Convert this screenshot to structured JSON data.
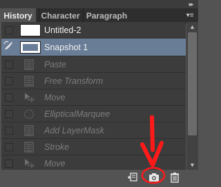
{
  "tabs": [
    {
      "label": "History",
      "active": true
    },
    {
      "label": "Character",
      "active": false
    },
    {
      "label": "Paragraph",
      "active": false
    }
  ],
  "icons": {
    "collapse": "double-chevron-right",
    "panel_menu": "panel-menu",
    "history_brush": "history-brush",
    "step_document": "document",
    "step_move": "move-tool",
    "step_marquee": "elliptical-marquee",
    "new_document": "new-document-from-state",
    "new_snapshot": "camera",
    "delete": "trash"
  },
  "snapshots": [
    {
      "label": "Untitled-2",
      "selected": false
    },
    {
      "label": "Snapshot 1",
      "selected": true,
      "history_source": true
    }
  ],
  "history_steps": [
    {
      "label": "Paste",
      "icon": "document"
    },
    {
      "label": "Free Transform",
      "icon": "document"
    },
    {
      "label": "Move",
      "icon": "move-tool"
    },
    {
      "label": "EllipticalMarquee",
      "icon": "elliptical-marquee"
    },
    {
      "label": "Add LayerMask",
      "icon": "document"
    },
    {
      "label": "Stroke",
      "icon": "document"
    },
    {
      "label": "Move",
      "icon": "move-tool"
    }
  ],
  "colors": {
    "panel_bg": "#535353",
    "list_bg": "#3c3c3c",
    "selected_row": "#6a7d96",
    "annotation": "#ff1a1a"
  }
}
